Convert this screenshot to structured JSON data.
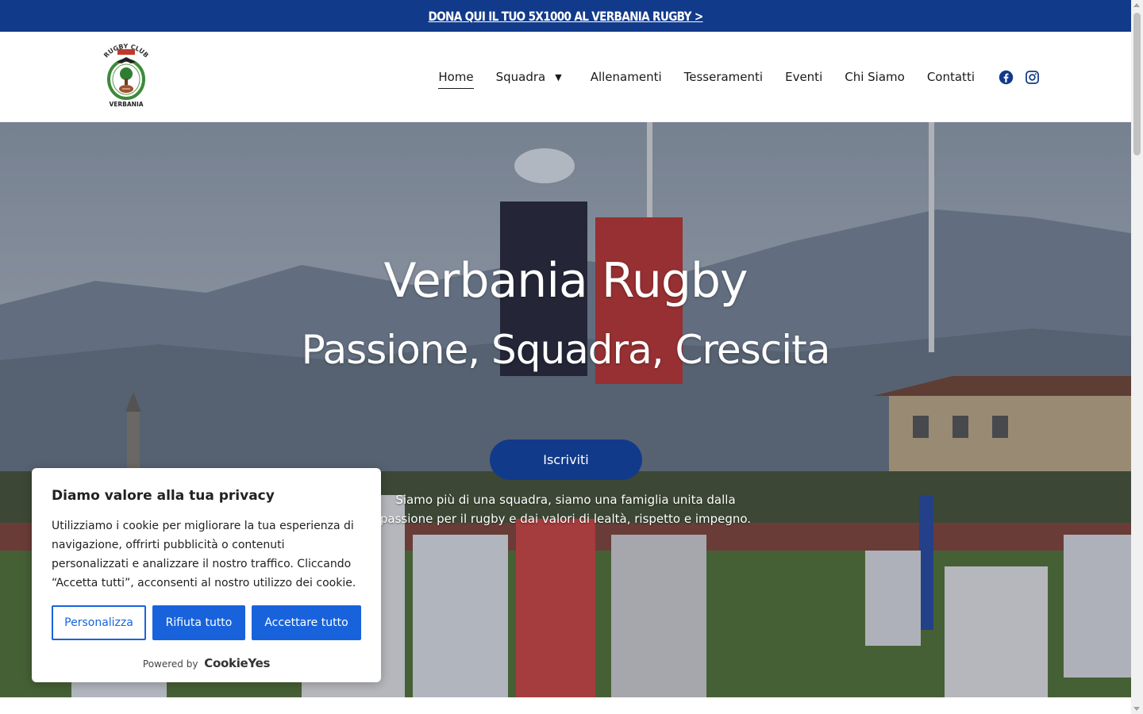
{
  "topbar": {
    "link_text": "DONA QUI IL TUO 5X1000 AL VERBANIA RUGBY >"
  },
  "logo": {
    "arc_top": "RUGBY CLUB",
    "bottom": "VERBANIA"
  },
  "nav": {
    "items": [
      {
        "label": "Home",
        "active": true
      },
      {
        "label": "Squadra",
        "has_dropdown": true
      },
      {
        "label": "Allenamenti"
      },
      {
        "label": "Tesseramenti"
      },
      {
        "label": "Eventi"
      },
      {
        "label": "Chi Siamo"
      },
      {
        "label": "Contatti"
      }
    ],
    "social": [
      "facebook-icon",
      "instagram-icon"
    ]
  },
  "hero": {
    "title": "Verbania Rugby",
    "subtitle": "Passione, Squadra, Crescita",
    "cta": "Iscriviti",
    "description": "Siamo più di una squadra, siamo una famiglia unita dalla passione per il rugby e dai valori di lealtà, rispetto e impegno."
  },
  "cookie": {
    "title": "Diamo valore alla tua privacy",
    "text": "Utilizziamo i cookie per migliorare la tua esperienza di navigazione, offrirti pubblicità o contenuti personalizzati e analizzare il nostro traffico. Cliccando “Accetta tutti”, acconsenti al nostro utilizzo dei cookie.",
    "customize": "Personalizza",
    "reject": "Rifiuta tutto",
    "accept": "Accettare tutto",
    "powered_by": "Powered by",
    "brand": "CookieYes"
  },
  "colors": {
    "brand_blue": "#123a8a",
    "cookie_blue": "#1863dc"
  }
}
